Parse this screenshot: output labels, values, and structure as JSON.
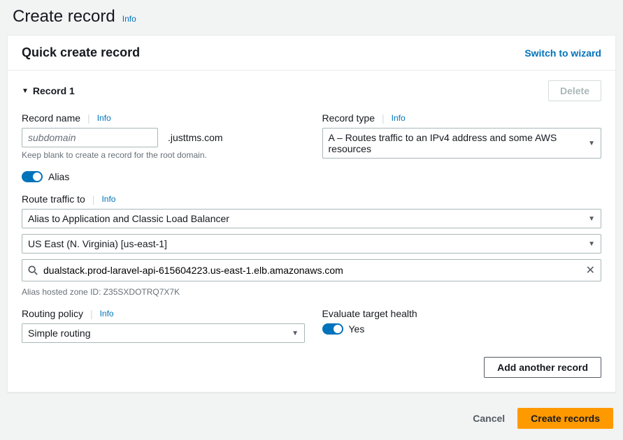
{
  "page": {
    "title": "Create record",
    "info_label": "Info"
  },
  "panel": {
    "title": "Quick create record",
    "switch_link": "Switch to wizard"
  },
  "record": {
    "title": "Record 1",
    "delete_label": "Delete"
  },
  "record_name": {
    "label": "Record name",
    "info": "Info",
    "placeholder": "subdomain",
    "suffix": ".justtms.com",
    "hint": "Keep blank to create a record for the root domain."
  },
  "record_type": {
    "label": "Record type",
    "info": "Info",
    "value": "A – Routes traffic to an IPv4 address and some AWS resources"
  },
  "alias": {
    "label": "Alias",
    "on": true
  },
  "route_traffic": {
    "label": "Route traffic to",
    "info": "Info",
    "alias_type": "Alias to Application and Classic Load Balancer",
    "region": "US East (N. Virginia) [us-east-1]",
    "target": "dualstack.prod-laravel-api-615604223.us-east-1.elb.amazonaws.com",
    "hint": "Alias hosted zone ID: Z35SXDOTRQ7X7K"
  },
  "routing_policy": {
    "label": "Routing policy",
    "info": "Info",
    "value": "Simple routing"
  },
  "target_health": {
    "label": "Evaluate target health",
    "value": "Yes"
  },
  "footer": {
    "add_another": "Add another record",
    "cancel": "Cancel",
    "create": "Create records"
  }
}
